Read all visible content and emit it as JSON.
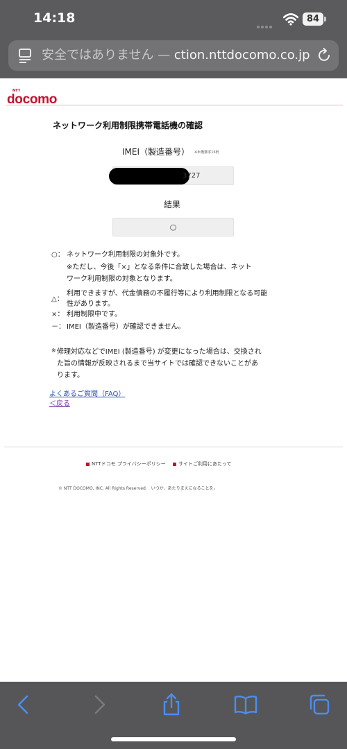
{
  "status_bar": {
    "time": "14:18",
    "battery": "84"
  },
  "address_bar": {
    "security_text": "安全ではありません — ",
    "domain_text": "ction.nttdocomo.co.jp"
  },
  "site": {
    "brand": "docomo",
    "brand_prefix": "NTT",
    "brand_color": "#c8102e"
  },
  "main": {
    "title": "ネットワーク利用制限携帯電話機の確認",
    "imei_label": "IMEI（製造番号）",
    "imei_note": "※半角数字15桁",
    "imei_value_visible": "3727",
    "result_label": "結果",
    "result_value": "○",
    "legend": [
      {
        "symbol": "○：",
        "lines": [
          "ネットワーク利用制限の対象外です。",
          "※ただし、今後「×」となる条件に合致した場合は、ネット",
          "ワーク利用制限の対象となります。"
        ]
      },
      {
        "symbol": "△：",
        "lines": [
          "利用できますが、代金債務の不履行等により利用制限となる可能",
          "性があります。"
        ]
      },
      {
        "symbol": "×：",
        "lines": [
          "利用制限中です。"
        ]
      },
      {
        "symbol": "－：",
        "lines": [
          "IMEI（製造番号）が確認できません。"
        ]
      }
    ],
    "note_mark": "※",
    "note_lines": [
      "修理対応などでIMEI (製造番号) が変更になった場合は、交換され",
      "た旨の情報が反映されるまで当サイトでは確認できないことがあ",
      "ります。"
    ],
    "faq_link": "よくあるご質問（FAQ）",
    "back_link": "＜戻る"
  },
  "footer": {
    "links": [
      "NTTドコモ プライバシーポリシー",
      "サイトご利用にあたって"
    ],
    "copyright": "© NTT DOCOMO, INC. All Rights Reserved.　いつか、あたりまえになることを。"
  },
  "toolbar": {
    "icons": [
      "back-icon",
      "forward-icon",
      "share-icon",
      "bookmarks-icon",
      "tabs-icon"
    ],
    "accent": "#4a8ef0"
  }
}
